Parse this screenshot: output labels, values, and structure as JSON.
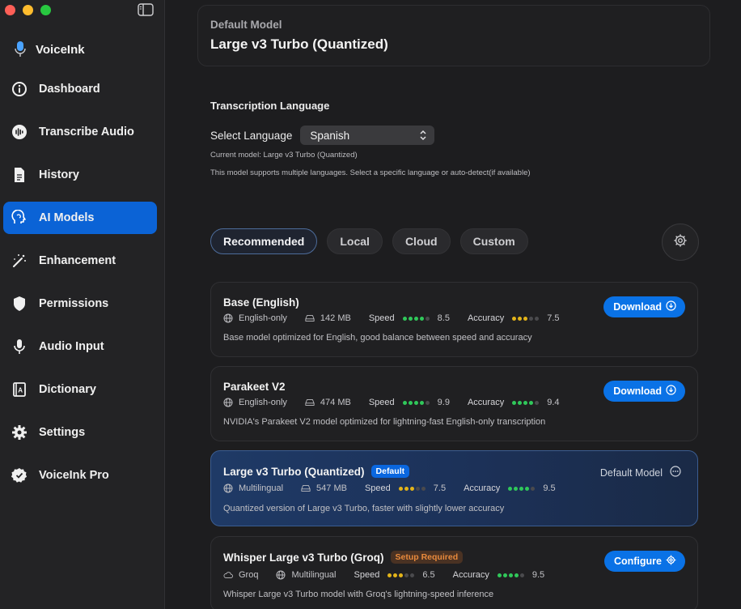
{
  "app": {
    "name": "VoiceInk"
  },
  "sidebar": {
    "items": [
      {
        "label": "Dashboard",
        "icon": "info-circle-icon",
        "active": false
      },
      {
        "label": "Transcribe Audio",
        "icon": "waveform-icon",
        "active": false
      },
      {
        "label": "History",
        "icon": "document-icon",
        "active": false
      },
      {
        "label": "AI Models",
        "icon": "brain-head-icon",
        "active": true
      },
      {
        "label": "Enhancement",
        "icon": "magic-wand-icon",
        "active": false
      },
      {
        "label": "Permissions",
        "icon": "shield-icon",
        "active": false
      },
      {
        "label": "Audio Input",
        "icon": "microphone-icon",
        "active": false
      },
      {
        "label": "Dictionary",
        "icon": "book-icon",
        "active": false
      },
      {
        "label": "Settings",
        "icon": "gear-icon",
        "active": false
      },
      {
        "label": "VoiceInk Pro",
        "icon": "seal-check-icon",
        "active": false
      }
    ]
  },
  "default_model": {
    "caption": "Default Model",
    "value": "Large v3 Turbo (Quantized)"
  },
  "language": {
    "title": "Transcription Language",
    "select_label": "Select Language",
    "selected": "Spanish",
    "note_current": "Current model: Large v3 Turbo (Quantized)",
    "note_support": "This model supports multiple languages. Select a specific language or auto-detect(if available)"
  },
  "tabs": [
    "Recommended",
    "Local",
    "Cloud",
    "Custom"
  ],
  "models": [
    {
      "name": "Base (English)",
      "language": "English-only",
      "size": "142 MB",
      "speed_label": "Speed",
      "speed": "8.5",
      "accuracy_label": "Accuracy",
      "accuracy": "7.5",
      "description": "Base model optimized for English, good balance between speed and accuracy",
      "action": "Download"
    },
    {
      "name": "Parakeet V2",
      "language": "English-only",
      "size": "474 MB",
      "speed_label": "Speed",
      "speed": "9.9",
      "accuracy_label": "Accuracy",
      "accuracy": "9.4",
      "description": "NVIDIA's Parakeet V2 model optimized for lightning-fast English-only transcription",
      "action": "Download"
    },
    {
      "name": "Large v3 Turbo (Quantized)",
      "badge": "Default",
      "language": "Multilingual",
      "size": "547 MB",
      "speed_label": "Speed",
      "speed": "7.5",
      "accuracy_label": "Accuracy",
      "accuracy": "9.5",
      "description": "Quantized version of Large v3 Turbo, faster with slightly lower accuracy",
      "status": "Default Model"
    },
    {
      "name": "Whisper Large v3 Turbo (Groq)",
      "badge": "Setup Required",
      "provider": "Groq",
      "language": "Multilingual",
      "speed_label": "Speed",
      "speed": "6.5",
      "accuracy_label": "Accuracy",
      "accuracy": "9.5",
      "description": "Whisper Large v3 Turbo model with Groq's lightning-speed inference",
      "action": "Configure"
    }
  ],
  "colors": {
    "accent": "#0a72e6",
    "selected_nav": "#0b63d6",
    "speed_green": "#30c85a",
    "speed_yellow": "#e3b419",
    "warning": "#e98a3c"
  }
}
